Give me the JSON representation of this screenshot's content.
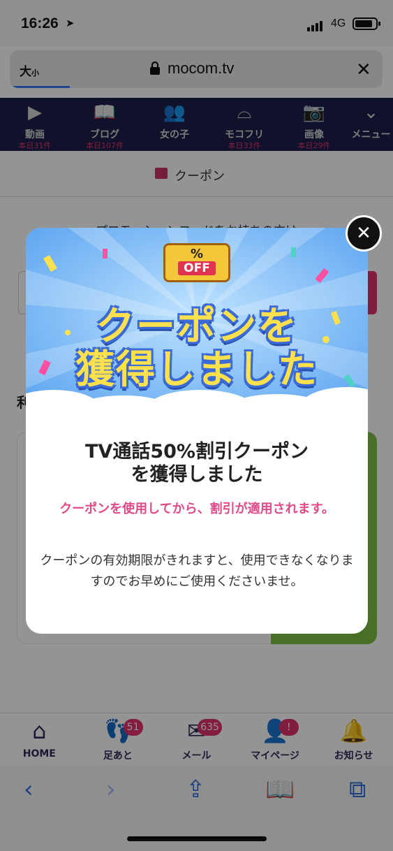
{
  "status_bar": {
    "time": "16:26",
    "location_arrow": "➤",
    "network": "4G"
  },
  "url_bar": {
    "text_size": "大",
    "text_size_small": "小",
    "domain": "mocom.tv",
    "close": "✕"
  },
  "site_nav": [
    {
      "label": "動画",
      "count": "本日31件",
      "icon": "video-icon",
      "glyph": "▶"
    },
    {
      "label": "ブログ",
      "count": "本日107件",
      "icon": "book-icon",
      "glyph": "📖"
    },
    {
      "label": "女の子",
      "count": "",
      "icon": "girls-icon",
      "glyph": "👥"
    },
    {
      "label": "モコフリ",
      "count": "本日33件",
      "icon": "panties-icon",
      "glyph": "⌓"
    },
    {
      "label": "画像",
      "count": "本日29件",
      "icon": "camera-icon",
      "glyph": "📷"
    },
    {
      "label": "メニュー",
      "count": "",
      "icon": "chevron-down-icon",
      "glyph": "⌄"
    }
  ],
  "page": {
    "title": "クーポン",
    "promo_text": "プロモーションコードをお持ちの方は",
    "section_head": "利"
  },
  "modal": {
    "badge_pct": "%",
    "badge_off": "OFF",
    "banner_line1": "クーポンを",
    "banner_line2": "獲得しました",
    "title_line1": "TV通話50%割引クーポン",
    "title_line2": "を獲得しました",
    "note": "クーポンを使用してから、割引が適用されます。",
    "body": "クーポンの有効期限がきれますと、使用できなくなりますのでお早めにご使用くださいませ。",
    "close": "✕"
  },
  "tab_bar": [
    {
      "label": "HOME",
      "badge": "",
      "icon": "home-icon",
      "glyph": "⌂"
    },
    {
      "label": "足あと",
      "badge": "51",
      "icon": "footprint-icon",
      "glyph": "👣"
    },
    {
      "label": "メール",
      "badge": "635",
      "icon": "mail-icon",
      "glyph": "✉"
    },
    {
      "label": "マイページ",
      "badge": "!",
      "icon": "user-icon",
      "glyph": "👤"
    },
    {
      "label": "お知らせ",
      "badge": "",
      "icon": "bell-icon",
      "glyph": "🔔"
    }
  ],
  "safari": {
    "back": "‹",
    "forward": "›",
    "share": "⇪",
    "bookmarks": "📖",
    "tabs": "⧉"
  }
}
